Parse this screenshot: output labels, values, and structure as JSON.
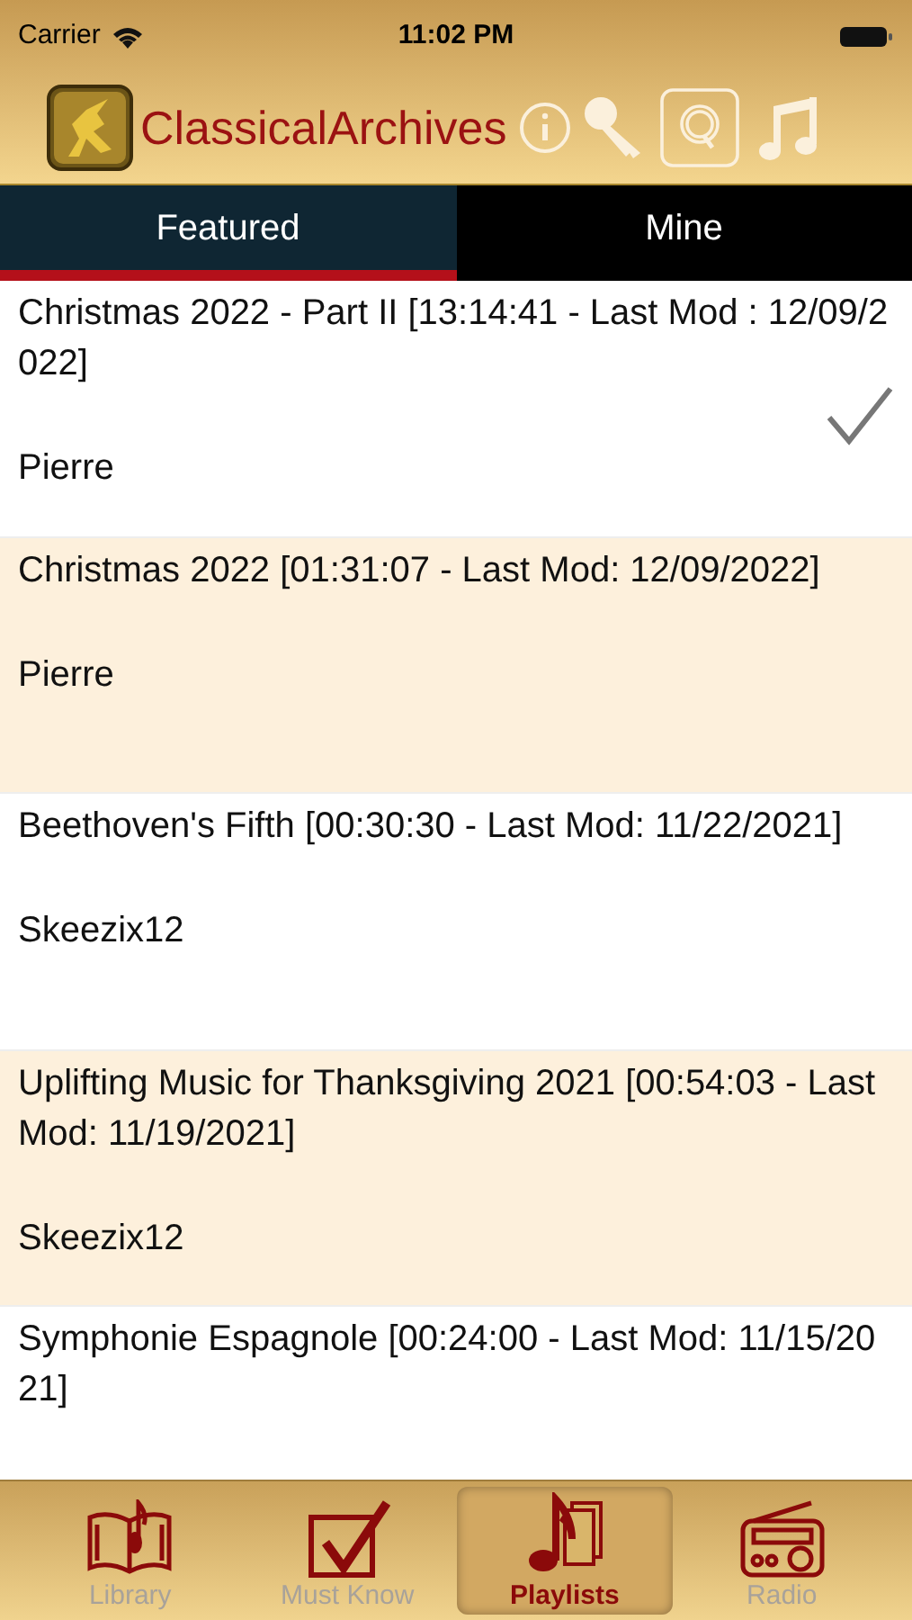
{
  "status_bar": {
    "carrier": "Carrier",
    "time": "11:02 PM"
  },
  "header": {
    "title": "ClassicalArchives"
  },
  "tabs": [
    {
      "label": "Featured",
      "selected": true
    },
    {
      "label": "Mine",
      "selected": false
    }
  ],
  "playlists": [
    {
      "title": "Christmas 2022 - Part II [13:14:41 - Last Mod : 12/09/2022]",
      "author": "Pierre",
      "checked": true
    },
    {
      "title": "Christmas 2022 [01:31:07 - Last Mod: 12/09/2022]",
      "author": "Pierre",
      "checked": false
    },
    {
      "title": "Beethoven's Fifth [00:30:30 - Last Mod: 11/22/2021]",
      "author": "Skeezix12",
      "checked": false
    },
    {
      "title": "Uplifting Music for Thanksgiving 2021 [00:54:03 - Last Mod: 11/19/2021]",
      "author": "Skeezix12",
      "checked": false
    },
    {
      "title": "Symphonie Espagnole [00:24:00 - Last Mod: 11/15/2021]",
      "checked": false
    }
  ],
  "tab_bar": [
    {
      "kind": "library",
      "label": "Library",
      "selected": false
    },
    {
      "kind": "must_know",
      "label": "Must Know",
      "selected": false
    },
    {
      "kind": "playlists",
      "label": "Playlists",
      "selected": true
    },
    {
      "kind": "radio",
      "label": "Radio",
      "selected": false
    }
  ]
}
